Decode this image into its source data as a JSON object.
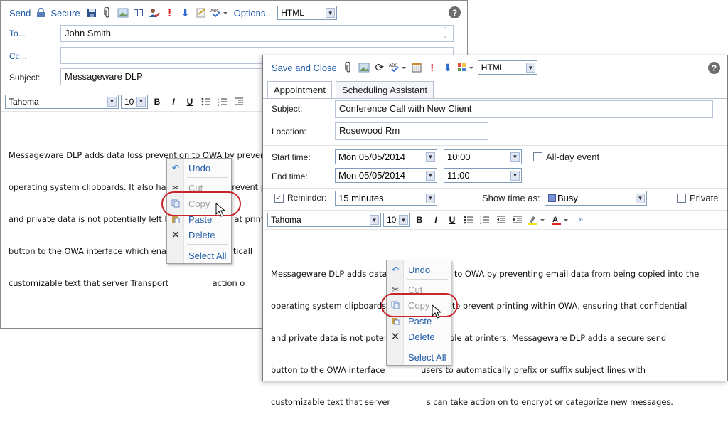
{
  "email": {
    "toolbar": {
      "send": "Send",
      "secure": "Secure",
      "options": "Options...",
      "format": "HTML"
    },
    "to_label": "To...",
    "to_value": "John Smith",
    "cc_label": "Cc...",
    "cc_value": "",
    "subject_label": "Subject:",
    "subject_value": "Messageware DLP",
    "font": "Tahoma",
    "size": "10",
    "body_lines": [
      "Messageware DLP adds data loss prevention to OWA by prevent",
      "operating system clipboards. It also has the ability to prevent pr",
      "and private data is not potentially left behind or visible at printer",
      "button to the OWA interface which enab                 omaticall",
      "customizable text that server Transport                 action o"
    ],
    "context_menu": {
      "undo": "Undo",
      "cut": "Cut",
      "copy": "Copy",
      "paste": "Paste",
      "delete": "Delete",
      "select_all": "Select All"
    }
  },
  "appointment": {
    "toolbar": {
      "save_close": "Save and Close",
      "format": "HTML"
    },
    "tabs": [
      "Appointment",
      "Scheduling Assistant"
    ],
    "subject_label": "Subject:",
    "subject_value": "Conference Call with New Client",
    "location_label": "Location:",
    "location_value": "Rosewood Rm",
    "start_label": "Start time:",
    "start_date": "Mon 05/05/2014",
    "start_time": "10:00",
    "all_day_label": "All-day event",
    "end_label": "End time:",
    "end_date": "Mon 05/05/2014",
    "end_time": "11:00",
    "reminder_label": "Reminder:",
    "reminder_value": "15 minutes",
    "show_as_label": "Show time as:",
    "show_as_value": "Busy",
    "private_label": "Private",
    "font": "Tahoma",
    "size": "10",
    "body_lines": [
      "Messageware DLP adds data loss prevention to OWA by preventing email data from being copied into the",
      "operating system clipboards.              ability to prevent printing within OWA, ensuring that confidential",
      "and private data is not poten              or visible at printers. Messageware DLP adds a secure send",
      "button to the OWA interface              users to automatically prefix or suffix subject lines with",
      "customizable text that server              s can take action on to encrypt or categorize new messages."
    ],
    "context_menu": {
      "undo": "Undo",
      "cut": "Cut",
      "copy": "Copy",
      "paste": "Paste",
      "delete": "Delete",
      "select_all": "Select All"
    }
  },
  "colors": {
    "link": "#1e5aa8",
    "highlight_ring": "#c8242b",
    "busy": "#7a8fd6"
  }
}
